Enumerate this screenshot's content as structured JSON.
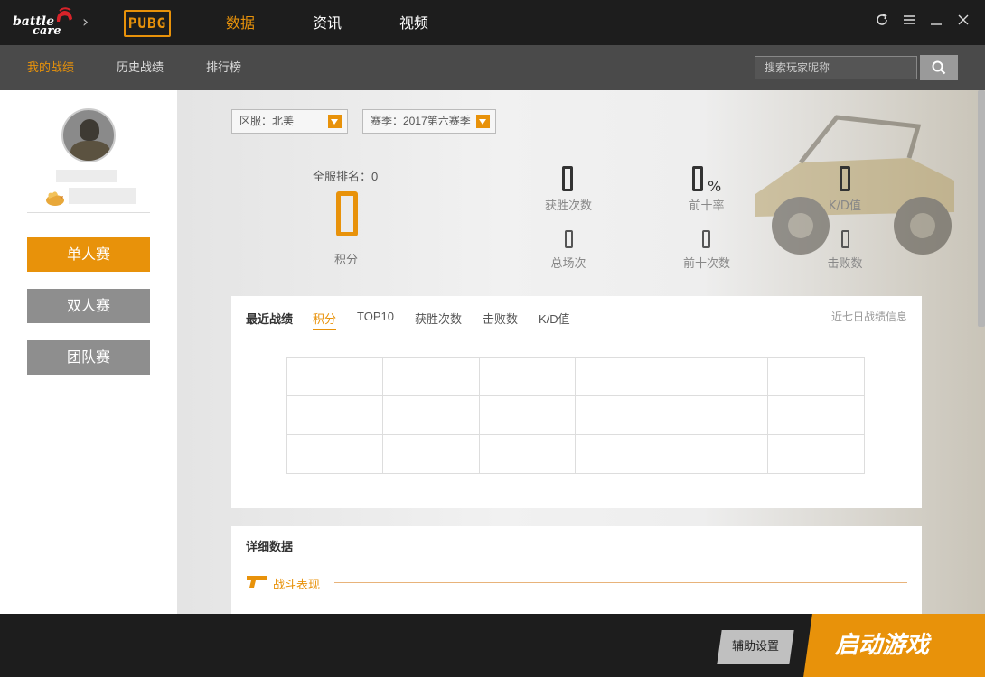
{
  "topbar": {
    "logo_line1": "battle",
    "logo_line2": "care",
    "game_logo": "PUBG",
    "nav": [
      "数据",
      "资讯",
      "视频"
    ],
    "active_nav": "数据"
  },
  "subnav": {
    "tabs": [
      "我的战绩",
      "历史战绩",
      "排行榜"
    ],
    "search_placeholder": "搜索玩家昵称"
  },
  "profile": {
    "modes": [
      "单人赛",
      "双人赛",
      "团队赛"
    ]
  },
  "filters": {
    "region": "区服：北美",
    "season": "赛季：2017第六赛季"
  },
  "stats": {
    "rank_text": "全服排名：0",
    "score_label": "积分",
    "win_label": "获胜次数",
    "top10_rate_label": "前十率",
    "top10_rate_unit": "%",
    "kd_label": "K/D值",
    "total_label": "总场次",
    "top10_count_label": "前十次数",
    "kills_label": "击败数"
  },
  "recent": {
    "title": "最近战绩",
    "tabs": [
      "积分",
      "TOP10",
      "获胜次数",
      "击败数",
      "K/D值"
    ],
    "right_note": "近七日战绩信息"
  },
  "detail": {
    "title": "详细数据",
    "section": "战斗表现"
  },
  "bottom": {
    "assist": "辅助设置",
    "launch": "启动游戏"
  },
  "colors": {
    "accent": "#e8920a",
    "topbar": "#1d1d1d",
    "subbar": "#4a4a4a"
  }
}
